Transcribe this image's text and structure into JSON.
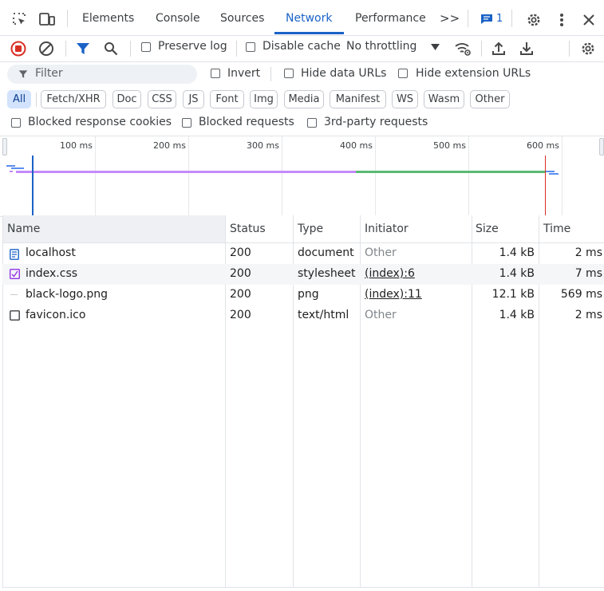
{
  "tabs": {
    "elements": "Elements",
    "console": "Console",
    "sources": "Sources",
    "network": "Network",
    "performance": "Performance",
    "more": ">>",
    "issues_count": "1"
  },
  "toolbar": {
    "preserve_log": "Preserve log",
    "disable_cache": "Disable cache",
    "throttling": "No throttling"
  },
  "filter": {
    "placeholder": "Filter",
    "invert": "Invert",
    "hide_data_urls": "Hide data URLs",
    "hide_extension_urls": "Hide extension URLs"
  },
  "chips": [
    "All",
    "Fetch/XHR",
    "Doc",
    "CSS",
    "JS",
    "Font",
    "Img",
    "Media",
    "Manifest",
    "WS",
    "Wasm",
    "Other"
  ],
  "blocked": {
    "cookies": "Blocked response cookies",
    "requests": "Blocked requests",
    "third_party": "3rd-party requests"
  },
  "overview": {
    "ticks": [
      "100 ms",
      "200 ms",
      "300 ms",
      "400 ms",
      "500 ms",
      "600 ms"
    ]
  },
  "table": {
    "headers": {
      "name": "Name",
      "status": "Status",
      "type": "Type",
      "initiator": "Initiator",
      "size": "Size",
      "time": "Time"
    },
    "rows": [
      {
        "name": "localhost",
        "status": "200",
        "type": "document",
        "initiator": "Other",
        "size": "1.4 kB",
        "time": "2 ms"
      },
      {
        "name": "index.css",
        "status": "200",
        "type": "stylesheet",
        "initiator": "(index):6",
        "size": "1.4 kB",
        "time": "7 ms"
      },
      {
        "name": "black-logo.png",
        "status": "200",
        "type": "png",
        "initiator": "(index):11",
        "size": "12.1 kB",
        "time": "569 ms"
      },
      {
        "name": "favicon.ico",
        "status": "200",
        "type": "text/html",
        "initiator": "Other",
        "size": "1.4 kB",
        "time": "2 ms"
      }
    ]
  },
  "colors": {
    "accent": "#1a62c7",
    "record_red": "#d93025",
    "waterfall_purple": "#c58af9",
    "waterfall_green": "#5bb974",
    "css_icon": "#9334e6"
  }
}
